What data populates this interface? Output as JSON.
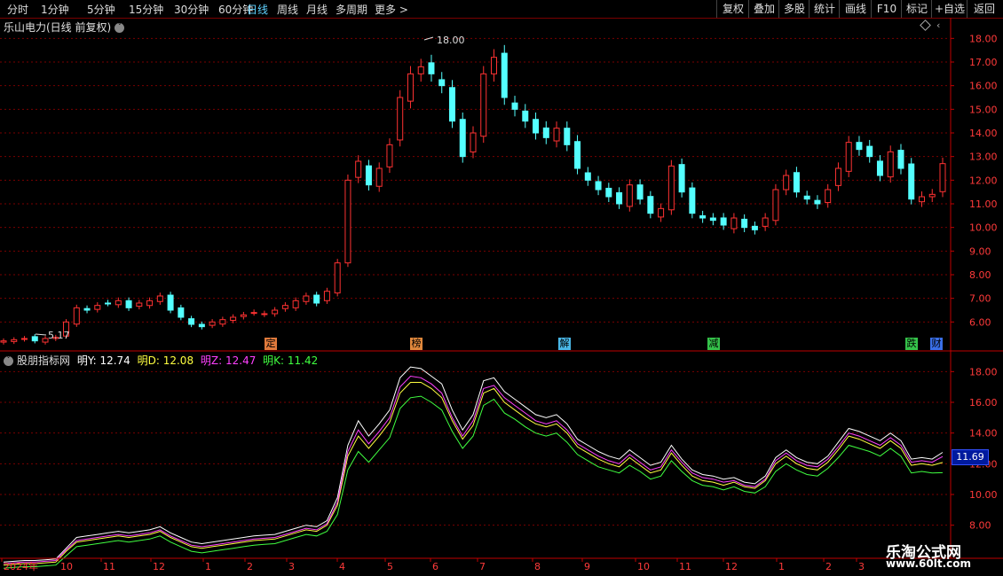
{
  "toolbar": {
    "periods": [
      "分时",
      "1分钟",
      "5分钟",
      "15分钟",
      "30分钟",
      "60分钟",
      "日线",
      "周线",
      "月线",
      "多周期",
      "更多"
    ],
    "active_period": "日线",
    "right_buttons": [
      "复权",
      "叠加",
      "多股",
      "统计",
      "画线",
      "F10",
      "标记",
      "+自选",
      "返回"
    ]
  },
  "main_chart": {
    "title": "乐山电力(日线 前复权)",
    "y_labels": [
      "18.00",
      "17.00",
      "16.00",
      "15.00",
      "14.00",
      "13.00",
      "12.00",
      "11.00",
      "10.00",
      "9.00",
      "8.00",
      "7.00",
      "6.00"
    ],
    "high_label": "18.00",
    "low_label": "5.17",
    "events": [
      {
        "label": "定",
        "color": "#e07a3c"
      },
      {
        "label": "榜",
        "color": "#e0883c"
      },
      {
        "label": "解",
        "color": "#4ab8e8"
      },
      {
        "label": "减",
        "color": "#35c24a"
      },
      {
        "label": "跌",
        "color": "#35c24a"
      },
      {
        "label": "财",
        "color": "#3a6fe8"
      }
    ]
  },
  "indicator": {
    "name": "股朋指标网",
    "values": [
      {
        "label": "明Y: 12.74",
        "color": "#ffffff"
      },
      {
        "label": "明D: 12.08",
        "color": "#ffff40"
      },
      {
        "label": "明Z: 12.47",
        "color": "#ff40ff"
      },
      {
        "label": "明K: 11.42",
        "color": "#40ff40"
      }
    ],
    "y_labels": [
      "18.00",
      "16.00",
      "14.00",
      "12.00",
      "10.00",
      "8.00"
    ],
    "price_tag": "11.69"
  },
  "x_axis": [
    "2024年",
    "10",
    "11",
    "12",
    "1",
    "2",
    "3",
    "4",
    "5",
    "6",
    "7",
    "8",
    "9",
    "10",
    "11",
    "12",
    "1",
    "2",
    "3"
  ],
  "watermark": {
    "line1": "乐淘公式网",
    "line2": "www.60lt.com"
  },
  "colors": {
    "up": "#ff3232",
    "down": "#54ffff",
    "grid": "#7a0000",
    "axis": "#c00000"
  },
  "chart_data": {
    "type": "candlestick",
    "series": [
      {
        "name": "price_close",
        "values": [
          5.2,
          5.25,
          5.3,
          5.2,
          5.3,
          5.35,
          6.0,
          6.6,
          6.5,
          6.7,
          6.8,
          6.9,
          6.6,
          6.8,
          6.9,
          7.1,
          6.5,
          6.2,
          5.9,
          5.8,
          6.0,
          6.1,
          6.2,
          6.3,
          6.4,
          6.35,
          6.5,
          6.7,
          6.9,
          7.1,
          6.8,
          7.3,
          8.5,
          12.0,
          12.8,
          11.8,
          12.5,
          13.5,
          15.5,
          16.5,
          16.8,
          16.5,
          16.0,
          14.5,
          13.0,
          14.0,
          16.5,
          17.2,
          15.5,
          15.0,
          14.5,
          14.0,
          13.8,
          14.2,
          13.5,
          12.5,
          12.0,
          11.6,
          11.3,
          11.0,
          11.8,
          11.2,
          10.6,
          10.8,
          12.6,
          11.5,
          10.6,
          10.4,
          10.3,
          10.1,
          10.4,
          10.0,
          9.9,
          10.4,
          11.6,
          12.2,
          11.5,
          11.2,
          11.0,
          11.6,
          12.5,
          13.6,
          13.3,
          13.0,
          12.2,
          13.2,
          12.5,
          11.2,
          11.3,
          11.4,
          12.7
        ]
      },
      {
        "name": "明Y",
        "values": [
          5.6,
          5.65,
          5.7,
          5.7,
          5.75,
          5.8,
          6.5,
          7.2,
          7.3,
          7.4,
          7.5,
          7.6,
          7.5,
          7.6,
          7.7,
          7.9,
          7.5,
          7.2,
          6.9,
          6.8,
          6.9,
          7.0,
          7.1,
          7.2,
          7.3,
          7.35,
          7.4,
          7.6,
          7.8,
          8.0,
          7.9,
          8.3,
          9.8,
          13.2,
          14.8,
          13.8,
          14.6,
          15.5,
          17.6,
          18.3,
          18.2,
          17.7,
          17.2,
          15.5,
          14.2,
          15.2,
          17.4,
          17.6,
          16.7,
          16.2,
          15.7,
          15.2,
          15.0,
          15.2,
          14.6,
          13.6,
          13.2,
          12.8,
          12.5,
          12.3,
          12.9,
          12.4,
          11.9,
          12.1,
          13.2,
          12.3,
          11.6,
          11.3,
          11.2,
          11.0,
          11.1,
          10.8,
          10.7,
          11.2,
          12.4,
          12.9,
          12.4,
          12.1,
          12.0,
          12.5,
          13.4,
          14.3,
          14.1,
          13.8,
          13.5,
          14.0,
          13.5,
          12.3,
          12.4,
          12.3,
          12.74
        ]
      },
      {
        "name": "明D",
        "values": [
          5.4,
          5.45,
          5.5,
          5.5,
          5.55,
          5.6,
          6.3,
          6.9,
          7.0,
          7.1,
          7.2,
          7.3,
          7.2,
          7.3,
          7.4,
          7.6,
          7.2,
          6.9,
          6.6,
          6.5,
          6.6,
          6.7,
          6.8,
          6.9,
          7.0,
          7.05,
          7.1,
          7.3,
          7.5,
          7.7,
          7.6,
          8.0,
          9.3,
          12.5,
          13.8,
          13.0,
          13.8,
          14.7,
          16.6,
          17.3,
          17.3,
          16.9,
          16.3,
          14.8,
          13.6,
          14.5,
          16.6,
          16.9,
          16.0,
          15.5,
          15.0,
          14.6,
          14.4,
          14.6,
          14.0,
          13.1,
          12.7,
          12.3,
          12.0,
          11.8,
          12.4,
          11.9,
          11.4,
          11.6,
          12.7,
          11.9,
          11.2,
          10.9,
          10.8,
          10.6,
          10.8,
          10.5,
          10.4,
          10.9,
          12.0,
          12.5,
          12.0,
          11.7,
          11.6,
          12.1,
          12.9,
          13.8,
          13.6,
          13.3,
          13.0,
          13.5,
          13.0,
          11.9,
          12.0,
          11.9,
          12.08
        ]
      },
      {
        "name": "明Z",
        "values": [
          5.5,
          5.55,
          5.6,
          5.6,
          5.65,
          5.7,
          6.4,
          7.0,
          7.1,
          7.2,
          7.3,
          7.4,
          7.3,
          7.4,
          7.5,
          7.7,
          7.3,
          7.0,
          6.7,
          6.6,
          6.7,
          6.8,
          6.9,
          7.0,
          7.1,
          7.15,
          7.2,
          7.4,
          7.6,
          7.8,
          7.7,
          8.1,
          9.5,
          12.8,
          14.2,
          13.3,
          14.1,
          15.0,
          17.0,
          17.7,
          17.6,
          17.2,
          16.6,
          15.0,
          13.8,
          14.8,
          16.9,
          17.1,
          16.3,
          15.8,
          15.3,
          14.8,
          14.6,
          14.8,
          14.2,
          13.3,
          12.9,
          12.5,
          12.2,
          12.0,
          12.6,
          12.1,
          11.6,
          11.8,
          12.9,
          12.1,
          11.4,
          11.1,
          11.0,
          10.8,
          10.9,
          10.6,
          10.5,
          11.0,
          12.2,
          12.7,
          12.2,
          11.9,
          11.8,
          12.3,
          13.1,
          14.0,
          13.8,
          13.5,
          13.2,
          13.7,
          13.2,
          12.1,
          12.2,
          12.1,
          12.47
        ]
      },
      {
        "name": "明K",
        "values": [
          5.2,
          5.25,
          5.3,
          5.3,
          5.35,
          5.4,
          6.0,
          6.6,
          6.7,
          6.8,
          6.9,
          7.0,
          6.9,
          7.0,
          7.1,
          7.3,
          6.9,
          6.6,
          6.3,
          6.2,
          6.3,
          6.4,
          6.5,
          6.6,
          6.7,
          6.75,
          6.8,
          7.0,
          7.2,
          7.4,
          7.3,
          7.6,
          8.7,
          11.6,
          12.8,
          12.1,
          12.9,
          13.7,
          15.6,
          16.3,
          16.4,
          16.0,
          15.5,
          14.1,
          13.0,
          13.8,
          15.8,
          16.2,
          15.3,
          14.9,
          14.4,
          14.0,
          13.8,
          14.0,
          13.4,
          12.6,
          12.2,
          11.8,
          11.6,
          11.4,
          11.9,
          11.5,
          11.0,
          11.2,
          12.2,
          11.5,
          10.9,
          10.6,
          10.5,
          10.3,
          10.5,
          10.2,
          10.1,
          10.5,
          11.5,
          12.0,
          11.6,
          11.3,
          11.2,
          11.7,
          12.4,
          13.2,
          13.0,
          12.8,
          12.5,
          13.0,
          12.5,
          11.4,
          11.5,
          11.4,
          11.42
        ]
      }
    ],
    "main_ylim": [
      5.0,
      18.5
    ],
    "indicator_ylim": [
      7.0,
      19.0
    ],
    "grid": true
  }
}
